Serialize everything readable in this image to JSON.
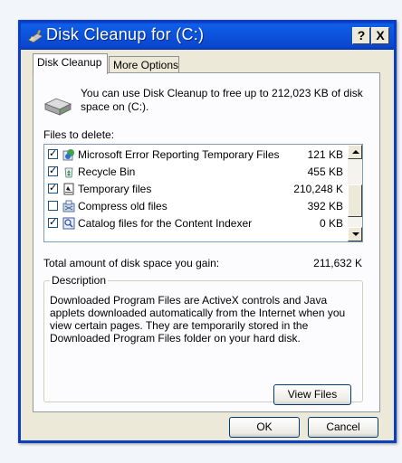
{
  "window": {
    "title": "Disk Cleanup for  (C:)",
    "help_label": "?",
    "close_label": "X"
  },
  "tabs": [
    {
      "label": "Disk Cleanup"
    },
    {
      "label": "More Options"
    }
  ],
  "intro_text": "You can use Disk Cleanup to free up to 212,023 KB of disk space on  (C:).",
  "files_label": "Files to delete:",
  "files": [
    {
      "name": "Microsoft Error Reporting Temporary Files",
      "size": "121 KB",
      "checked": true,
      "icon": "error-report-icon"
    },
    {
      "name": "Recycle Bin",
      "size": "455 KB",
      "checked": true,
      "icon": "recycle-bin-icon"
    },
    {
      "name": "Temporary files",
      "size": "210,248 K",
      "checked": true,
      "icon": "temp-files-icon"
    },
    {
      "name": "Compress old files",
      "size": "392 KB",
      "checked": false,
      "icon": "compress-icon"
    },
    {
      "name": "Catalog files for the Content Indexer",
      "size": "0 KB",
      "checked": true,
      "icon": "catalog-icon"
    }
  ],
  "total_label": "Total amount of disk space you gain:",
  "total_value": "211,632 K",
  "description": {
    "legend": "Description",
    "text": "Downloaded Program Files are ActiveX controls and Java applets downloaded automatically from the Internet when you view certain pages. They are temporarily stored in the Downloaded Program Files folder on your hard disk."
  },
  "buttons": {
    "view_files": "View Files",
    "ok": "OK",
    "cancel": "Cancel"
  },
  "colors": {
    "titlebar": "#0a4ad9",
    "dialog": "#ece9d8",
    "panel": "#fcfcfe",
    "list_border": "#7f9db9"
  }
}
